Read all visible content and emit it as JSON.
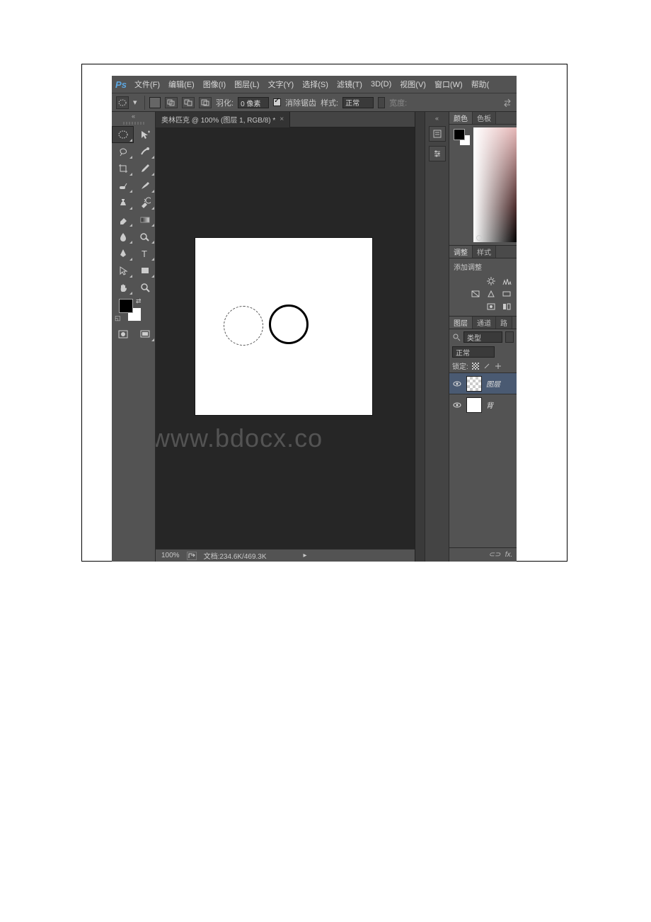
{
  "app": {
    "logo": "Ps"
  },
  "menu": {
    "file": "文件(F)",
    "edit": "编辑(E)",
    "image": "图像(I)",
    "layer": "图层(L)",
    "type": "文字(Y)",
    "select": "选择(S)",
    "filter": "滤镜(T)",
    "threed": "3D(D)",
    "view": "视图(V)",
    "window": "窗口(W)",
    "help": "帮助("
  },
  "options": {
    "feather_label": "羽化:",
    "feather_value": "0 像素",
    "antialias_label": "消除锯齿",
    "style_label": "样式:",
    "style_value": "正常",
    "width_label": "宽度:"
  },
  "document": {
    "tab_title": "奥林匹克 @ 100% (图层 1, RGB/8) *"
  },
  "watermark": "www.bdocx.co",
  "status": {
    "zoom": "100%",
    "doc_info": "文档:234.6K/469.3K"
  },
  "panels": {
    "color_tab": "颜色",
    "swatches_tab": "色板",
    "adjust_tab": "调整",
    "styles_tab": "样式",
    "adjust_title": "添加调整",
    "layers_tab": "图层",
    "channels_tab": "通道",
    "paths_tab": "路",
    "filter_type": "类型",
    "blend_mode": "正常",
    "lock_label": "锁定:",
    "layers": [
      {
        "name": "图层",
        "selected": true,
        "thumb": "trans"
      },
      {
        "name": "背",
        "selected": false,
        "thumb": "white"
      }
    ]
  },
  "tools": {
    "marquee": "elliptical-marquee-tool",
    "move": "move-tool",
    "lasso": "lasso-tool",
    "quickselect": "quick-selection-tool",
    "crop": "crop-tool",
    "eyedropper": "eyedropper-tool",
    "healing": "healing-brush-tool",
    "brush": "brush-tool",
    "stamp": "clone-stamp-tool",
    "history": "history-brush-tool",
    "eraser": "eraser-tool",
    "gradient": "gradient-tool",
    "blur": "blur-tool",
    "dodge": "dodge-tool",
    "pen": "pen-tool",
    "type": "type-tool",
    "path": "path-selection-tool",
    "shape": "rectangle-tool",
    "hand": "hand-tool",
    "zoom": "zoom-tool",
    "quickmask": "quick-mask-tool",
    "screenmode": "screen-mode-tool"
  }
}
